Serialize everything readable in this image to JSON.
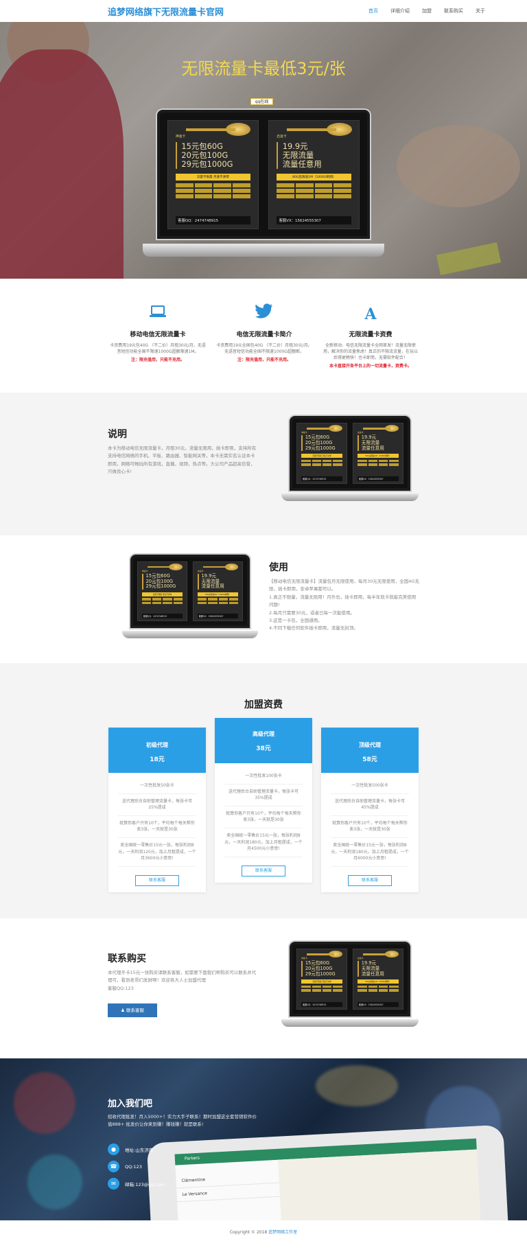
{
  "header": {
    "logo": "追梦网络旗下无限流量卡官网",
    "nav": [
      "首页",
      "详细介绍",
      "加盟",
      "联系购买",
      "关于"
    ]
  },
  "hero": {
    "title": "无限流量卡最低3元/张",
    "badge": "qq在线"
  },
  "product_card": {
    "left": {
      "name": "神速卡",
      "lines": [
        "15元包60G",
        "20元包100G",
        "29元包1000G"
      ],
      "tag": "流量不限量   月底不清零",
      "contact": "客服QQ：2474748915"
    },
    "right": {
      "name": "启速卡",
      "lines": [
        "19.9元",
        "无限流量",
        "流量任意用"
      ],
      "tag": "80G后限速1M（1000G断网）",
      "contact": "客服VX：15624555307"
    }
  },
  "features": [
    {
      "icon": "laptop-icon",
      "title": "移动电信无限流量卡",
      "desc": "卡资费用19元包40G （不二价）月租30元/月，无语音短信功能全国不限速1000G超额限速1M。",
      "note": "注：限充值用，只能不充用。"
    },
    {
      "icon": "twitter-icon",
      "title": "电信无限流量卡简介",
      "desc": "卡资费用19元全国包40G （不二价）月租30元/月。无语音短信功能全国不限速1000G超额断。",
      "note": "注：限充值用，只能不充用。"
    },
    {
      "icon": "letter-a-icon",
      "title": "无限流量卡资费",
      "desc": "全新移动、电信无限流量卡全网首发！流量无限使用，解决你的流量焦虑！真正的不限流流量，在玩以后得更畅快！也卡即用，无需软件配合！",
      "note": "本卡直接开各平台上的一切流量卡，资费卡。"
    }
  ],
  "about": {
    "title": "说明",
    "text": "本卡为移动电信无限流量卡，月租30元，流量无限用，插卡即用，支持所有支持电信网络的手机、平板、路由器、智能网关等，本卡无需实名认证本卡即用，网络可畅玩所有游戏，直播，视频，热点等。大公司产品超高信誉，只做良心卡!"
  },
  "usage": {
    "title": "使用",
    "intro": "【移动电信无限流量卡】流量包月无限使用，每月30元无限使用，全国4G无限，插卡即用，安卓苹果都可以。",
    "items": [
      "1.真正不限量，流量无限用！月外也，插卡即用，每半年就卡就能完美使用问题!",
      "2.每月只需要30元，或者已每一次能使用。",
      "3.这是一卡包，全国通用。",
      "4.不同下载任何软件插卡即用，流量无封顶。"
    ]
  },
  "pricing": {
    "title": "加盟资费",
    "plans": [
      {
        "name": "初级代理",
        "price": "18元",
        "items": [
          "一次性批发50张卡",
          "送代理后台自助管理流量卡，每张卡可25%提成",
          "就算你客户只有10个，平均每个每天帮你卖3张，一天就是30张",
          "卖全国统一零售价15元一张，每张利润8元，一天利润120元，加上月租提成，一个月3600元小意思!"
        ],
        "button": "联系客服"
      },
      {
        "name": "高级代理",
        "price": "38元",
        "items": [
          "一次性批发100张卡",
          "送代理后台自助管理流量卡，每张卡可35%提成",
          "就算你客户只有10个，平均每个每天帮你卖3张，一天就是30张",
          "卖全国统一零售价15元一张，每张利润8元，一天利润180元，加上月租提成，一个月4500元小意思!"
        ],
        "button": "联系客服"
      },
      {
        "name": "顶级代理",
        "price": "58元",
        "items": [
          "一次性批发500张卡",
          "送代理后台自助管理流量卡，每张卡可45%提成",
          "就算你客户只有10个，平均每个每天帮你卖3张，一天就是30张",
          "卖全国统一零售价15元一张，每张利润8元，一天利润180元，加上月租提成，一个月6000元小意思!"
        ],
        "button": "联系客服"
      }
    ]
  },
  "contact": {
    "title": "联系购买",
    "text": "本代理平卡15元一张购买请联系客服，如需要下面我们帮购买可以联系并代理可，看到老哥们发财啊！欢迎各大人士加盟代理",
    "qq": "客服QQ:123",
    "button": "联系客服"
  },
  "join": {
    "title": "加入我们吧",
    "desc": "招收代理批发！月入5000+！实力大手子联系！期时加盟这全套营销软件价值888+ 批发价让你来到赚！赚钱赚！就是联系!",
    "rows": [
      {
        "icon": "location-icon",
        "text": "地址:山东济南"
      },
      {
        "icon": "phone-icon",
        "text": "QQ:123"
      },
      {
        "icon": "mail-icon",
        "text": "邮箱:123@qq.com"
      }
    ],
    "tablet": {
      "app": "Parkers",
      "items": [
        "Clémentine",
        "Le Versance"
      ]
    }
  },
  "footer": {
    "text": "Copyright © 2018",
    "link": "追梦网络工作室"
  }
}
